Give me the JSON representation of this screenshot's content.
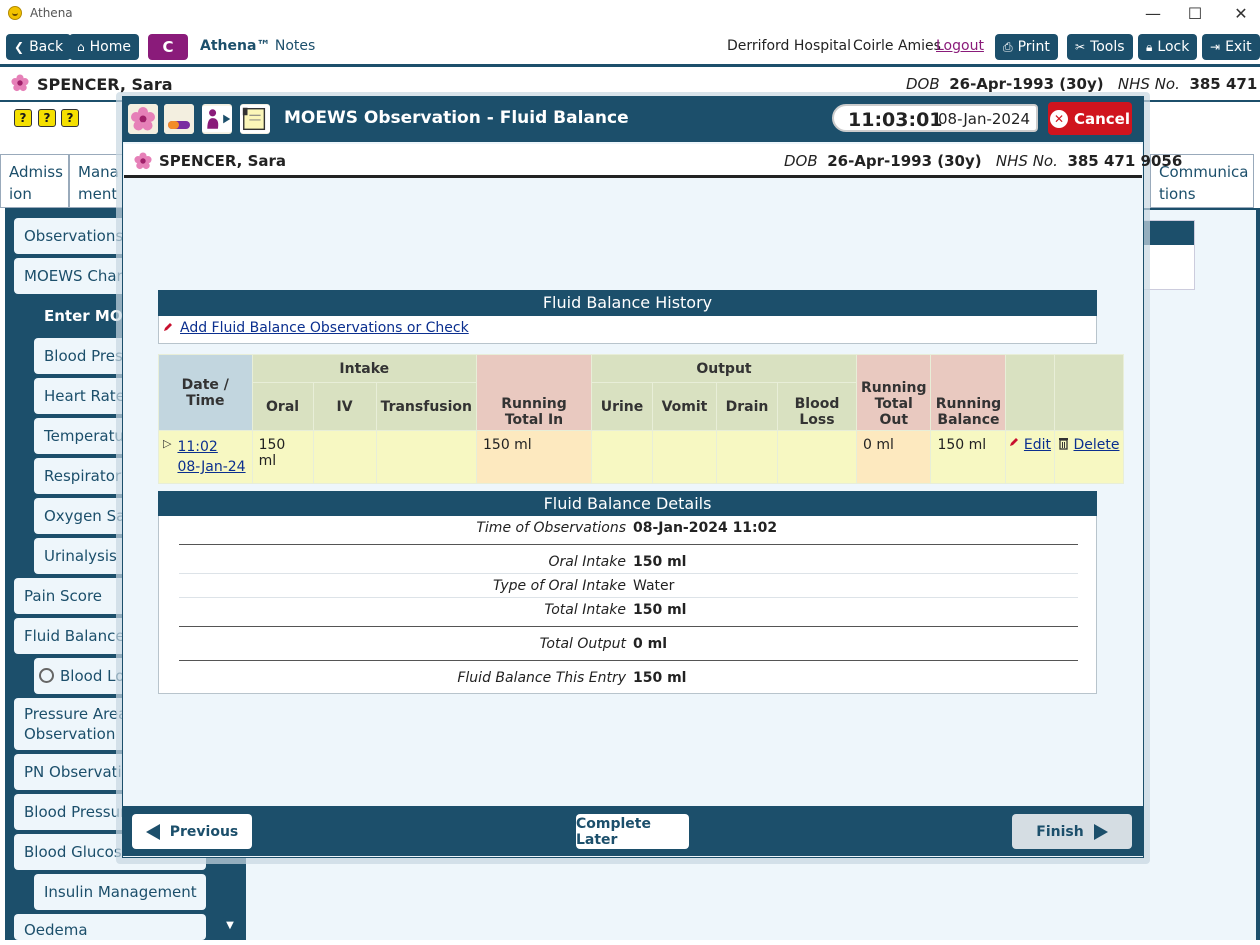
{
  "window": {
    "title": "Athena",
    "minimize": "—",
    "maximize": "☐",
    "close": "✕"
  },
  "toolbar": {
    "back": "Back",
    "home": "Home",
    "c": "C",
    "app_name": "Athena™",
    "app_module": "Notes",
    "hospital": "Derriford Hospital",
    "user": "Coirle Amies",
    "logout": "Logout",
    "print": "Print",
    "tools": "Tools",
    "lock": "Lock",
    "exit": "Exit"
  },
  "patient": {
    "name": "SPENCER, Sara",
    "dob_label": "DOB",
    "dob": "26-Apr-1993 (30y)",
    "nhs_label": "NHS No.",
    "nhs": "385 471 9056"
  },
  "background": {
    "alert_icons": [
      "?",
      "?",
      "?"
    ],
    "tabs": [
      "Admiss ion",
      "Mana ment",
      "Communica tions"
    ],
    "sidebar": [
      "Observations",
      "MOEWS Chart",
      "Enter MOEWS",
      "Blood Press",
      "Heart Rate",
      "Temperature",
      "Respiratory",
      "Oxygen Sat",
      "Urinalysis",
      "Pain Score",
      "Fluid Balance",
      "Blood Loss",
      "Pressure Areas Observation",
      "PN Observation",
      "Blood Pressure",
      "Blood Glucose",
      "Insulin Management",
      "Oedema"
    ]
  },
  "modal": {
    "title": "MOEWS Observation - Fluid Balance",
    "time": "11:03:01",
    "date": "08-Jan-2024",
    "cancel": "Cancel"
  },
  "history": {
    "title": "Fluid Balance History",
    "add_link": "Add Fluid Balance Observations or Check",
    "group_intake": "Intake",
    "group_output": "Output",
    "columns": {
      "datetime": "Date / Time",
      "oral": "Oral",
      "iv": "IV",
      "transfusion": "Transfusion",
      "running_in": "Running Total In",
      "urine": "Urine",
      "vomit": "Vomit",
      "drain": "Drain",
      "blood_loss": "Blood Loss",
      "running_out": "Running Total Out",
      "running_balance": "Running Balance"
    },
    "rows": [
      {
        "time": "11:02",
        "date": "08-Jan-24",
        "oral": "150 ml",
        "iv": "",
        "transfusion": "",
        "running_in": "150 ml",
        "urine": "",
        "vomit": "",
        "drain": "",
        "blood_loss": "",
        "running_out": "0 ml",
        "running_balance": "150 ml",
        "edit": "Edit",
        "delete": "Delete"
      }
    ]
  },
  "details": {
    "title": "Fluid Balance Details",
    "time_label": "Time of Observations",
    "time_value": "08-Jan-2024 11:02",
    "oral_label": "Oral Intake",
    "oral_value": "150 ml",
    "type_label": "Type of Oral Intake",
    "type_value": "Water",
    "total_in_label": "Total Intake",
    "total_in_value": "150 ml",
    "total_out_label": "Total Output",
    "total_out_value": "0 ml",
    "balance_label": "Fluid Balance This Entry",
    "balance_value": "150 ml"
  },
  "footer": {
    "previous": "Previous",
    "complete_later": "Complete Later",
    "finish": "Finish"
  },
  "colors": {
    "brand": "#1c4f6b",
    "accent": "#8a1b7a",
    "cancel": "#d0141e",
    "intake_row": "#f7f8c2",
    "running_cell": "#fde9bf"
  }
}
